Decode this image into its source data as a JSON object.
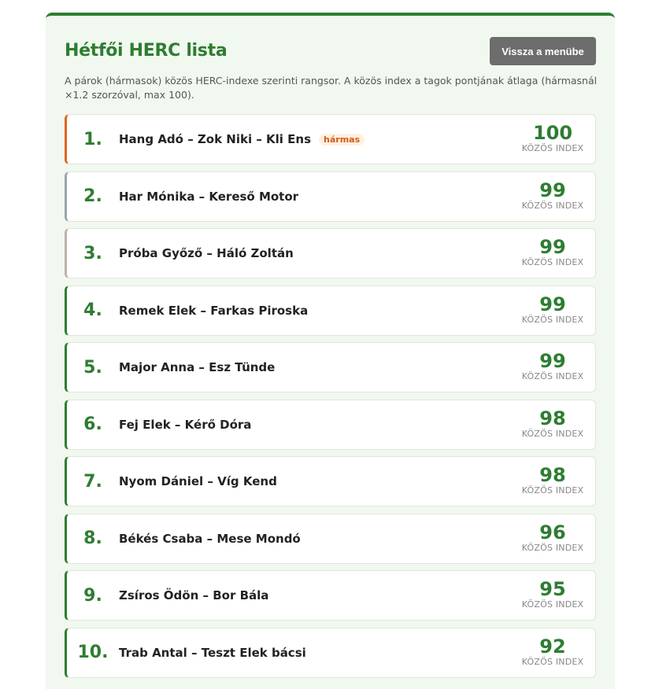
{
  "header": {
    "title": "Hétfői HERC lista",
    "back_button_label": "Vissza a menübe",
    "description": "A párok (hármasok) közös HERC-indexe szerinti rangsor. A közös index a tagok pontjának átlaga (hármasnál ×1.2 szorzóval, max 100)."
  },
  "score_label": "KÖZÖS INDEX",
  "accent_colors": {
    "primary": "#2e7d32",
    "rank1_border": "#e0661f",
    "rank2_border": "#9aa5ad",
    "rank3_border": "#bdb2a8"
  },
  "ranking": [
    {
      "rank": "1.",
      "names": "Hang Adó – Zok Niki – Kli Ens",
      "badge": "hármas",
      "score": "100"
    },
    {
      "rank": "2.",
      "names": "Har Mónika – Kereső Motor",
      "score": "99"
    },
    {
      "rank": "3.",
      "names": "Próba Győző – Háló Zoltán",
      "score": "99"
    },
    {
      "rank": "4.",
      "names": "Remek Elek – Farkas Piroska",
      "score": "99"
    },
    {
      "rank": "5.",
      "names": "Major Anna – Esz Tünde",
      "score": "99"
    },
    {
      "rank": "6.",
      "names": "Fej Elek – Kérő Dóra",
      "score": "98"
    },
    {
      "rank": "7.",
      "names": "Nyom Dániel – Víg Kend",
      "score": "98"
    },
    {
      "rank": "8.",
      "names": "Békés Csaba – Mese Mondó",
      "score": "96"
    },
    {
      "rank": "9.",
      "names": "Zsíros Ödön – Bor Bála",
      "score": "95"
    },
    {
      "rank": "10.",
      "names": "Trab Antal – Teszt Elek bácsi",
      "score": "92"
    }
  ]
}
